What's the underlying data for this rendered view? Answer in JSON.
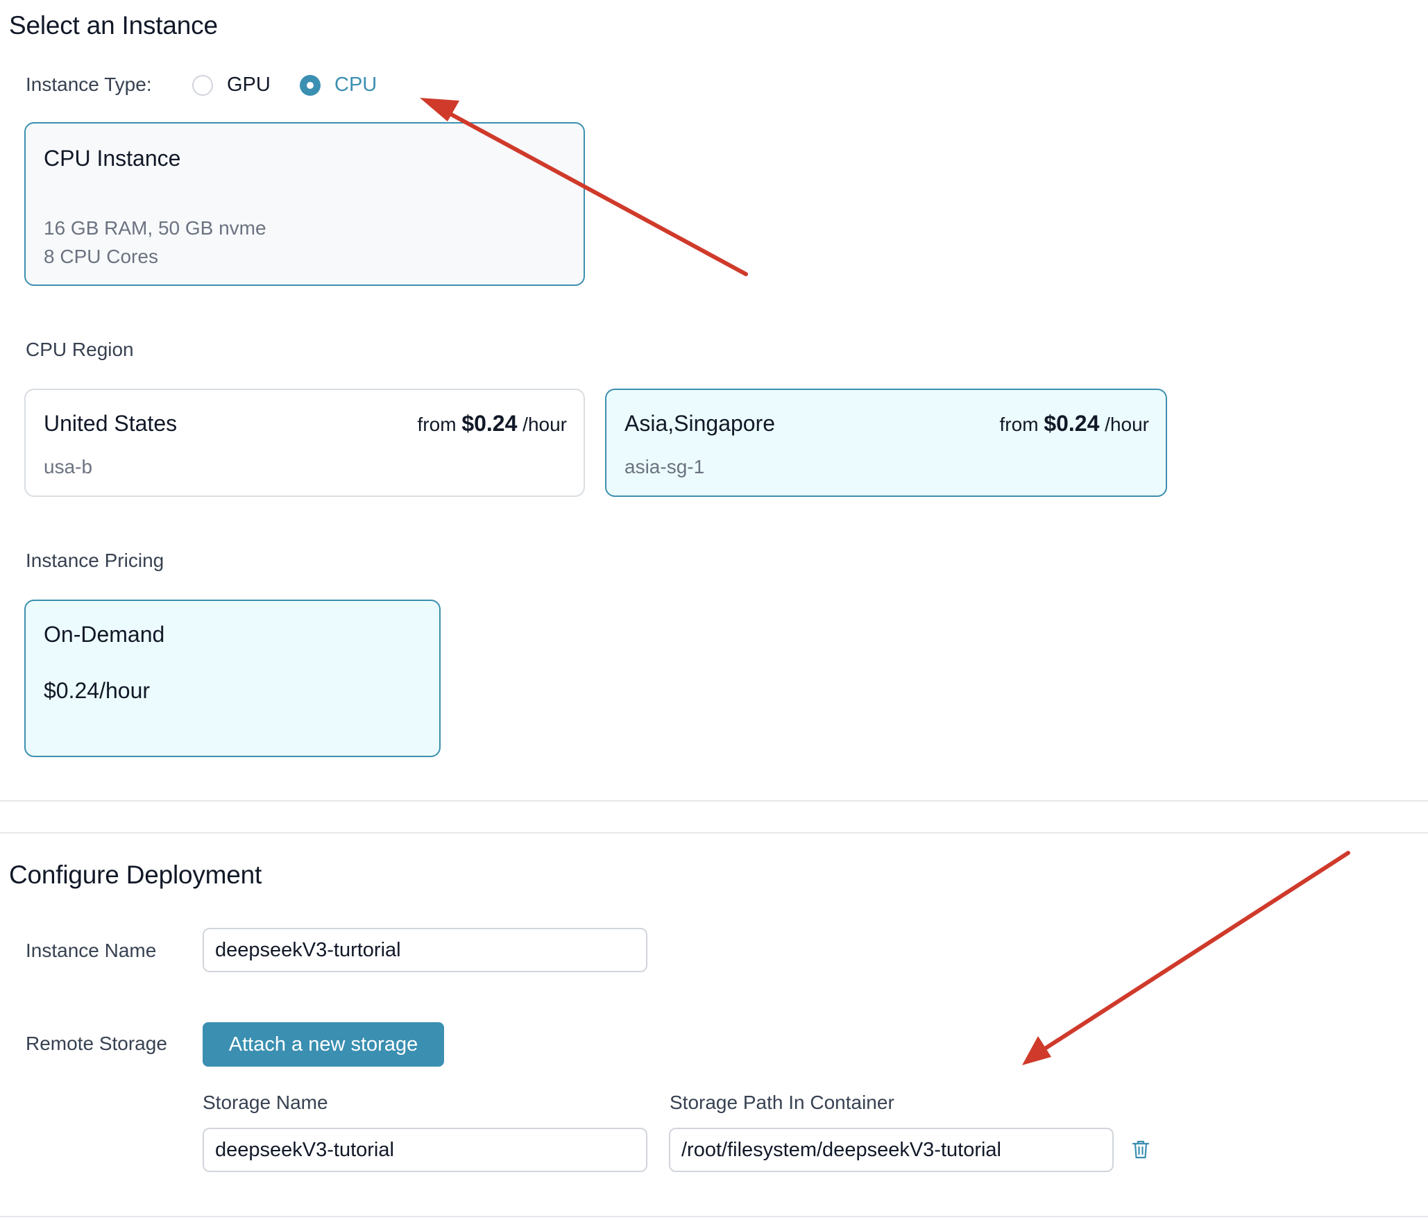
{
  "select_instance": {
    "title": "Select an Instance",
    "instance_type_label": "Instance Type:",
    "options": [
      {
        "label": "GPU",
        "selected": false
      },
      {
        "label": "CPU",
        "selected": true
      }
    ],
    "instance_card": {
      "title": "CPU Instance",
      "specs_line1": "16 GB RAM, 50 GB nvme",
      "specs_line2": "8 CPU Cores"
    },
    "region_label": "CPU Region",
    "regions": [
      {
        "name": "United States",
        "code": "usa-b",
        "from": "from",
        "price": "$0.24",
        "unit": "/hour",
        "selected": false
      },
      {
        "name": "Asia,Singapore",
        "code": "asia-sg-1",
        "from": "from",
        "price": "$0.24",
        "unit": "/hour",
        "selected": true
      }
    ],
    "pricing_label": "Instance Pricing",
    "pricing_card": {
      "title": "On-Demand",
      "price": "$0.24/hour"
    }
  },
  "configure": {
    "title": "Configure Deployment",
    "instance_name_label": "Instance Name",
    "instance_name_value": "deepseekV3-turtorial",
    "remote_storage_label": "Remote Storage",
    "attach_button": "Attach a new storage",
    "storage_name_label": "Storage Name",
    "storage_name_value": "deepseekV3-tutorial",
    "storage_path_label": "Storage Path In Container",
    "storage_path_value": "/root/filesystem/deepseekV3-tutorial"
  },
  "colors": {
    "accent": "#3b8fb1",
    "selected_bg": "#ecfbfd",
    "annotation_arrow": "#cf3a2b"
  },
  "icons": {
    "delete": "trash-icon"
  }
}
